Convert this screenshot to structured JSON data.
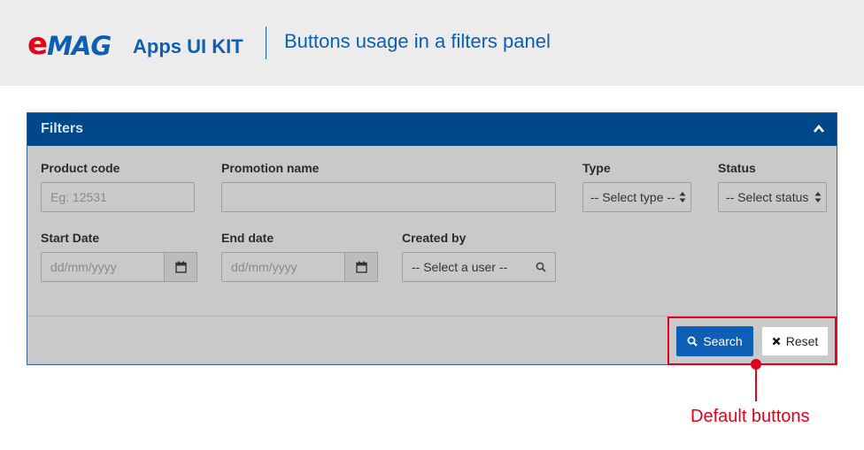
{
  "header": {
    "logo_e": "e",
    "logo_mag": "MAG",
    "subtitle": "Apps UI KIT",
    "title": "Buttons usage in a filters panel"
  },
  "panel": {
    "title": "Filters",
    "fields": {
      "product_code": {
        "label": "Product code",
        "placeholder": "Eg: 12531"
      },
      "promotion_name": {
        "label": "Promotion name",
        "placeholder": ""
      },
      "type": {
        "label": "Type",
        "value": "-- Select type --"
      },
      "status": {
        "label": "Status",
        "value": "-- Select status"
      },
      "start_date": {
        "label": "Start Date",
        "placeholder": "dd/mm/yyyy"
      },
      "end_date": {
        "label": "End date",
        "placeholder": "dd/mm/yyyy"
      },
      "created_by": {
        "label": "Created by",
        "value": "-- Select a user --"
      }
    },
    "buttons": {
      "search": "Search",
      "reset": "Reset"
    }
  },
  "annotation": {
    "label": "Default buttons",
    "color": "#e2001a"
  },
  "colors": {
    "brand_blue": "#0c5fb5",
    "panel_header": "#00488a",
    "brand_red": "#e2001a"
  }
}
